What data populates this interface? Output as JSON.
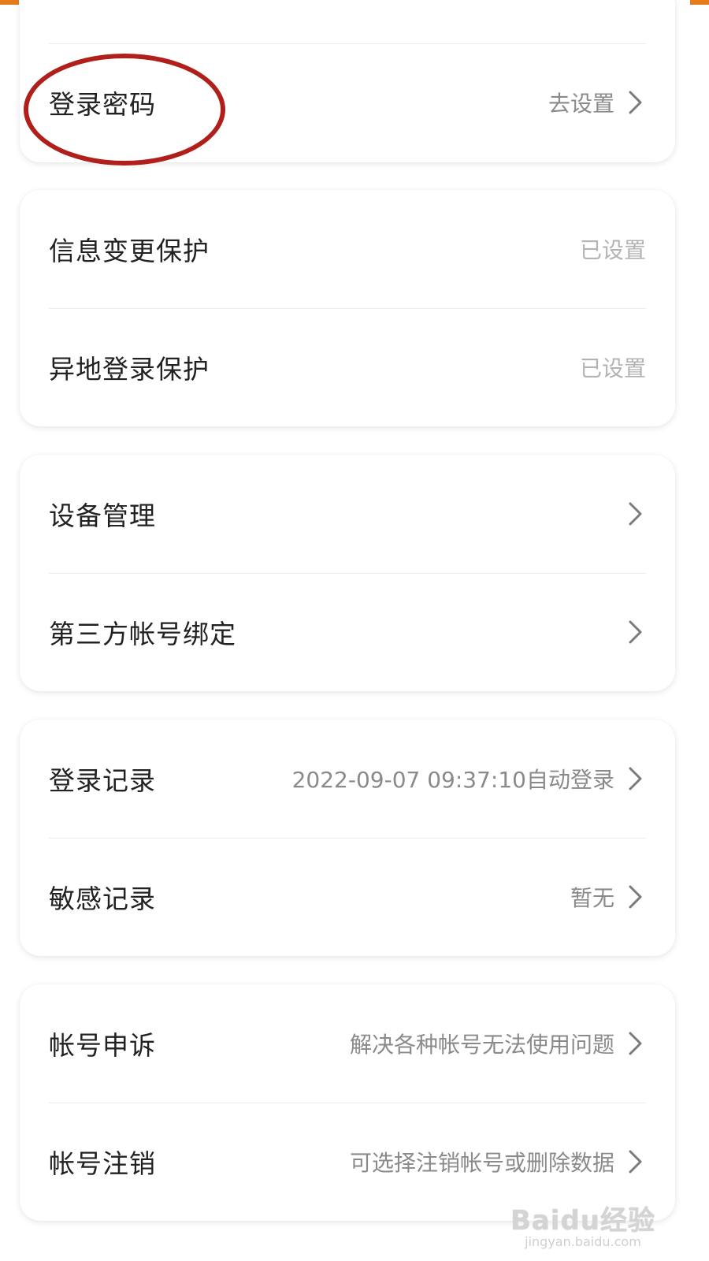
{
  "colors": {
    "accent_orange": "#e57b1c",
    "highlight_red": "#b01f1a",
    "text_primary": "#222222",
    "text_secondary": "#8a8a8a",
    "text_muted": "#b3b3b3"
  },
  "cards": [
    {
      "rows": [
        {
          "label": "登录密码",
          "value": "去设置",
          "chevron": true
        }
      ]
    },
    {
      "rows": [
        {
          "label": "信息变更保护",
          "value": "已设置",
          "chevron": false
        },
        {
          "label": "异地登录保护",
          "value": "已设置",
          "chevron": false
        }
      ]
    },
    {
      "rows": [
        {
          "label": "设备管理",
          "value": "",
          "chevron": true
        },
        {
          "label": "第三方帐号绑定",
          "value": "",
          "chevron": true
        }
      ]
    },
    {
      "rows": [
        {
          "label": "登录记录",
          "value": "2022-09-07 09:37:10自动登录",
          "chevron": true
        },
        {
          "label": "敏感记录",
          "value": "暂无",
          "chevron": true
        }
      ]
    },
    {
      "rows": [
        {
          "label": "帐号申诉",
          "value": "解决各种帐号无法使用问题",
          "chevron": true
        },
        {
          "label": "帐号注销",
          "value": "可选择注销帐号或删除数据",
          "chevron": true
        }
      ]
    }
  ],
  "watermark": {
    "main": "Baidu经验",
    "sub": "jingyan.baidu.com"
  }
}
